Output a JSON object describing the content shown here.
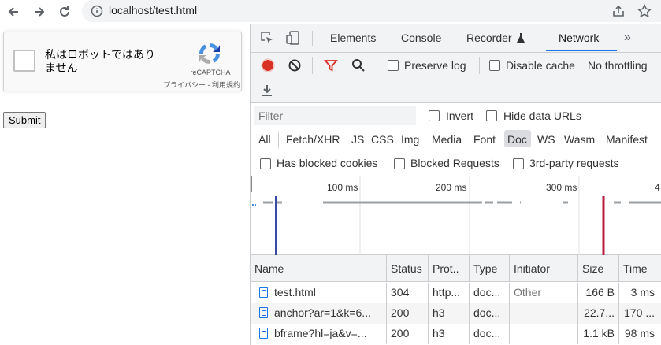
{
  "browser": {
    "url": "localhost/test.html"
  },
  "page": {
    "recaptcha": {
      "label": "私はロボットではありません",
      "brand": "reCAPTCHA",
      "terms": "プライバシー - 利用規約"
    },
    "submit_label": "Submit"
  },
  "devtools": {
    "tabs": [
      "Elements",
      "Console",
      "Recorder",
      "Network"
    ],
    "active_tab": "Network",
    "toolbar": {
      "preserve_log": "Preserve log",
      "disable_cache": "Disable cache",
      "throttling": "No throttling"
    },
    "filter": {
      "placeholder": "Filter",
      "invert": "Invert",
      "hide_data_urls": "Hide data URLs",
      "types": [
        "All",
        "Fetch/XHR",
        "JS",
        "CSS",
        "Img",
        "Media",
        "Font",
        "Doc",
        "WS",
        "Wasm",
        "Manifest"
      ],
      "active_type": "Doc",
      "has_blocked_cookies": "Has blocked cookies",
      "blocked_requests": "Blocked Requests",
      "third_party": "3rd-party requests"
    },
    "timeline": {
      "ticks": [
        "100 ms",
        "200 ms",
        "300 ms",
        "4"
      ]
    },
    "table": {
      "columns": [
        "Name",
        "Status",
        "Prot..",
        "Type",
        "Initiator",
        "Size",
        "Time"
      ],
      "rows": [
        {
          "name": "test.html",
          "status": "304",
          "protocol": "http...",
          "type": "doc...",
          "initiator": "Other",
          "size": "166 B",
          "time": "3 ms"
        },
        {
          "name": "anchor?ar=1&k=6...",
          "status": "200",
          "protocol": "h3",
          "type": "doc...",
          "initiator": "",
          "size": "22.7...",
          "time": "170 ..."
        },
        {
          "name": "bframe?hl=ja&v=...",
          "status": "200",
          "protocol": "h3",
          "type": "doc...",
          "initiator": "",
          "size": "1.1 kB",
          "time": "98 ms"
        }
      ]
    }
  }
}
